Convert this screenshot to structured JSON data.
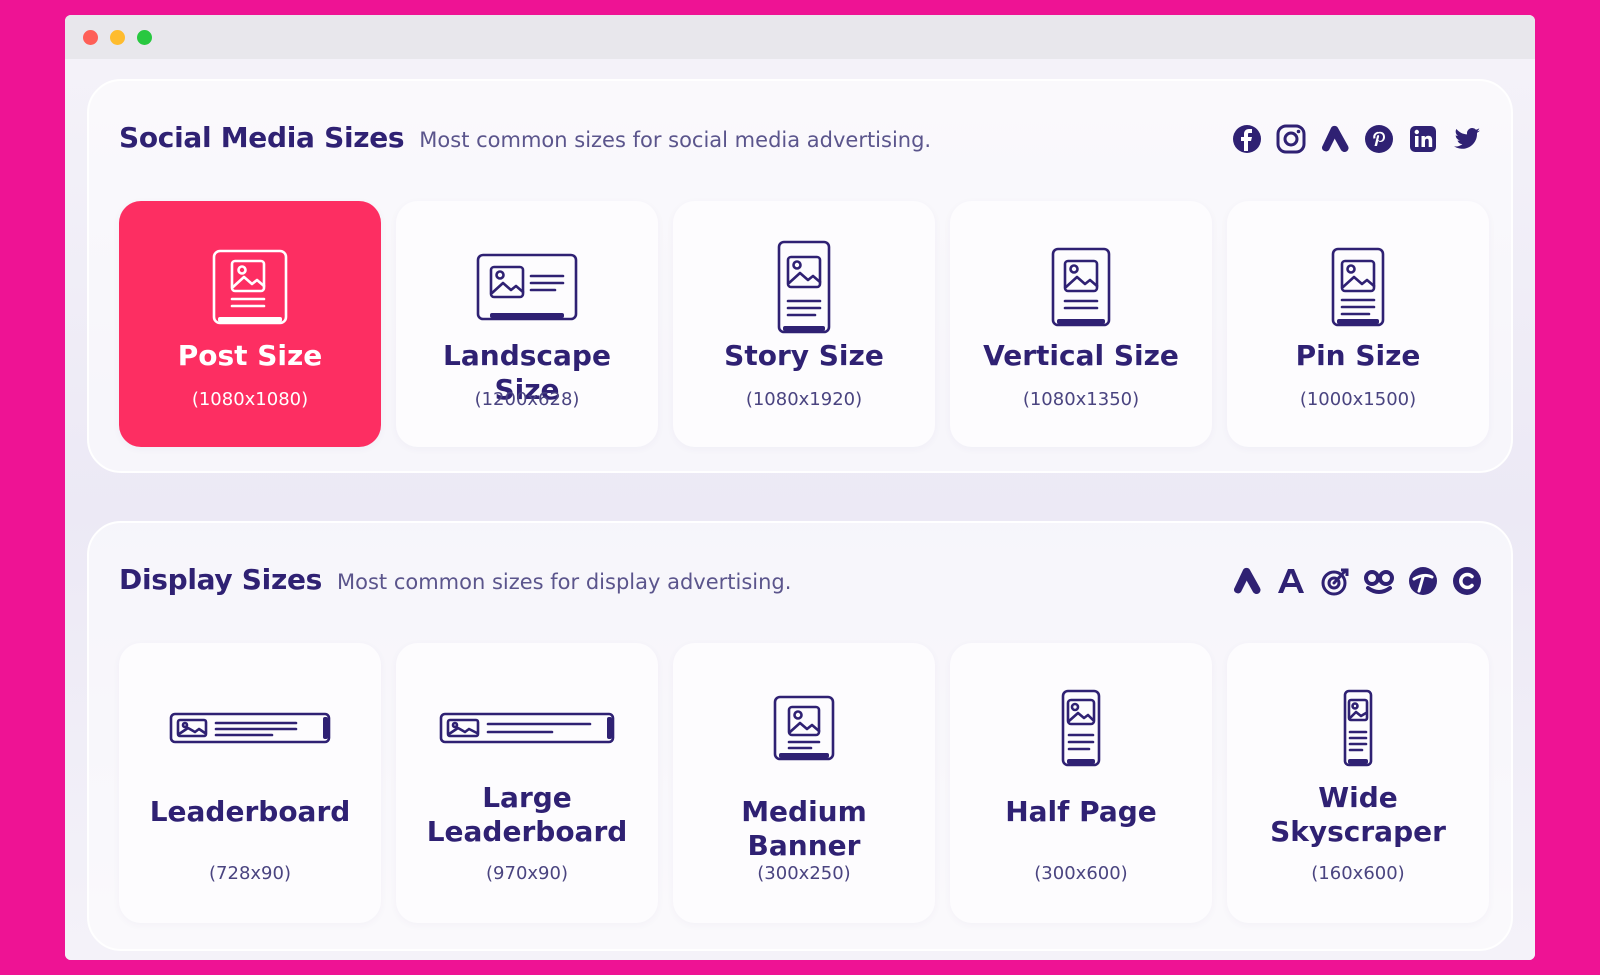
{
  "window": {
    "controls": [
      "close",
      "minimize",
      "zoom"
    ]
  },
  "social": {
    "title": "Social Media Sizes",
    "description": "Most common sizes for social media advertising.",
    "brand_icons": [
      "facebook-icon",
      "instagram-icon",
      "google-ads-icon",
      "pinterest-icon",
      "linkedin-icon",
      "twitter-icon"
    ],
    "cards": [
      {
        "title": "Post Size",
        "size": "(1080x1080)",
        "icon": "post-size-icon",
        "active": true
      },
      {
        "title": "Landscape Size",
        "size": "(1200x628)",
        "icon": "landscape-size-icon",
        "active": false
      },
      {
        "title": "Story Size",
        "size": "(1080x1920)",
        "icon": "story-size-icon",
        "active": false
      },
      {
        "title": "Vertical Size",
        "size": "(1080x1350)",
        "icon": "vertical-size-icon",
        "active": false
      },
      {
        "title": "Pin Size",
        "size": "(1000x1500)",
        "icon": "pin-size-icon",
        "active": false
      }
    ]
  },
  "display": {
    "title": "Display Sizes",
    "description": "Most common sizes for display advertising.",
    "brand_icons": [
      "google-ads-icon",
      "adroll-icon",
      "target-icon",
      "outbrain-icon",
      "taboola-icon",
      "criteo-icon"
    ],
    "cards": [
      {
        "title": "Leaderboard",
        "size": "(728x90)",
        "icon": "leaderboard-icon"
      },
      {
        "title_line1": "Large",
        "title_line2": "Leaderboard",
        "size": "(970x90)",
        "icon": "large-leaderboard-icon"
      },
      {
        "title": "Medium Banner",
        "size": "(300x250)",
        "icon": "medium-banner-icon"
      },
      {
        "title": "Half Page",
        "size": "(300x600)",
        "icon": "half-page-icon"
      },
      {
        "title_line1": "Wide",
        "title_line2": "Skyscraper",
        "size": "(160x600)",
        "icon": "wide-skyscraper-icon"
      }
    ]
  },
  "colors": {
    "background": "#ee1394",
    "accent": "#fd2e62",
    "text": "#2f2173"
  }
}
